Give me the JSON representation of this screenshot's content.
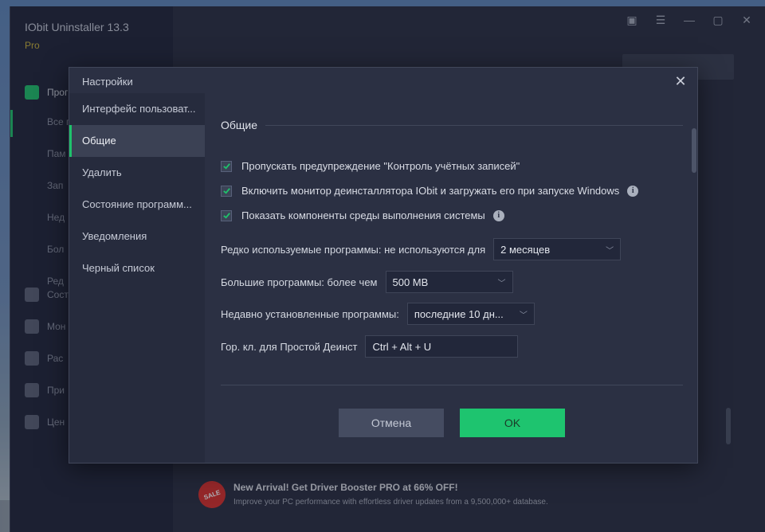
{
  "app": {
    "title": "IObit Uninstaller 13.3",
    "edition": "Pro",
    "sidebar_items": [
      {
        "label": "Прог",
        "icon": "grid-icon",
        "active": true
      },
      {
        "label": "Сост",
        "icon": "monitor-icon"
      },
      {
        "label": "Мон",
        "icon": "chart-icon"
      },
      {
        "label": "Рас",
        "icon": "puzzle-icon"
      },
      {
        "label": "При",
        "icon": "windows-icon"
      },
      {
        "label": "Цен",
        "icon": "flag-icon"
      }
    ],
    "sub_items": [
      "Все п",
      "Пам",
      "Зап",
      "Нед",
      "Бол",
      "Ред"
    ],
    "promo": {
      "badge": "SALE",
      "title": "New Arrival! Get Driver Booster PRO at 66% OFF!",
      "text": "Improve your PC performance with effortless driver updates from a 9,500,000+ database."
    }
  },
  "dialog": {
    "title": "Настройки",
    "nav": [
      {
        "label": "Интерфейс пользоват..."
      },
      {
        "label": "Общие",
        "active": true
      },
      {
        "label": "Удалить"
      },
      {
        "label": "Состояние программ..."
      },
      {
        "label": "Уведомления"
      },
      {
        "label": "Черный список"
      }
    ],
    "section_title": "Общие",
    "checkboxes": [
      {
        "label": "Пропускать предупреждение \"Контроль учётных записей\"",
        "checked": true,
        "info": false
      },
      {
        "label": "Включить монитор деинсталлятора IObit и загружать его при запуске Windows",
        "checked": true,
        "info": true
      },
      {
        "label": "Показать компоненты среды выполнения системы",
        "checked": true,
        "info": true
      }
    ],
    "rarely_used_label": "Редко используемые программы: не используются для",
    "rarely_used_value": "2 месяцев",
    "large_label": "Большие программы: более чем",
    "large_value": "500 MB",
    "recent_label": "Недавно установленные программы:",
    "recent_value": "последние 10 дн...",
    "hotkey_label": "Гор. кл. для Простой Деинст",
    "hotkey_value": "Ctrl + Alt + U",
    "cancel_label": "Отмена",
    "ok_label": "OK"
  },
  "colors": {
    "accent_green": "#1ec46f",
    "dialog_bg": "#2b3043",
    "app_bg": "#2a2f41"
  }
}
